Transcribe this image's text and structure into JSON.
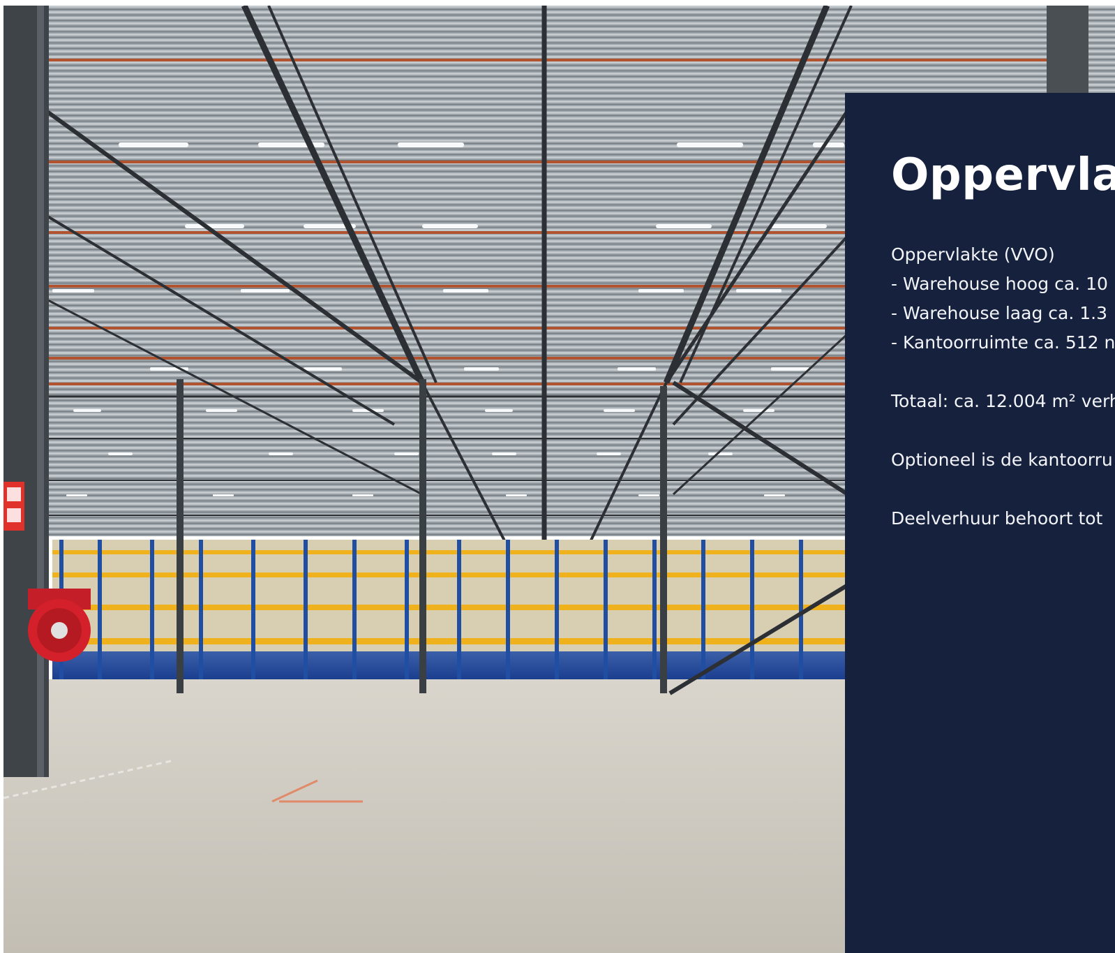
{
  "photo": {
    "subject": "warehouse-interior",
    "colors": {
      "roof": "#8f969c",
      "beam": "#2f3338",
      "rack_yellow": "#f0b21c",
      "rack_blue": "#1f4ea3",
      "floor": "#cfcac0",
      "fire_hose": "#d4202a",
      "sign_red": "#e0312a"
    }
  },
  "panel": {
    "background": "#16213e",
    "title": "Oppervlak",
    "lines": [
      "Oppervlakte (VVO)",
      "- Warehouse hoog ca. 10",
      "- Warehouse laag ca. 1.3",
      "- Kantoorruimte ca. 512 n",
      "Totaal: ca. 12.004 m² verh",
      "Optioneel is de kantoorru",
      "Deelverhuur behoort tot"
    ]
  }
}
